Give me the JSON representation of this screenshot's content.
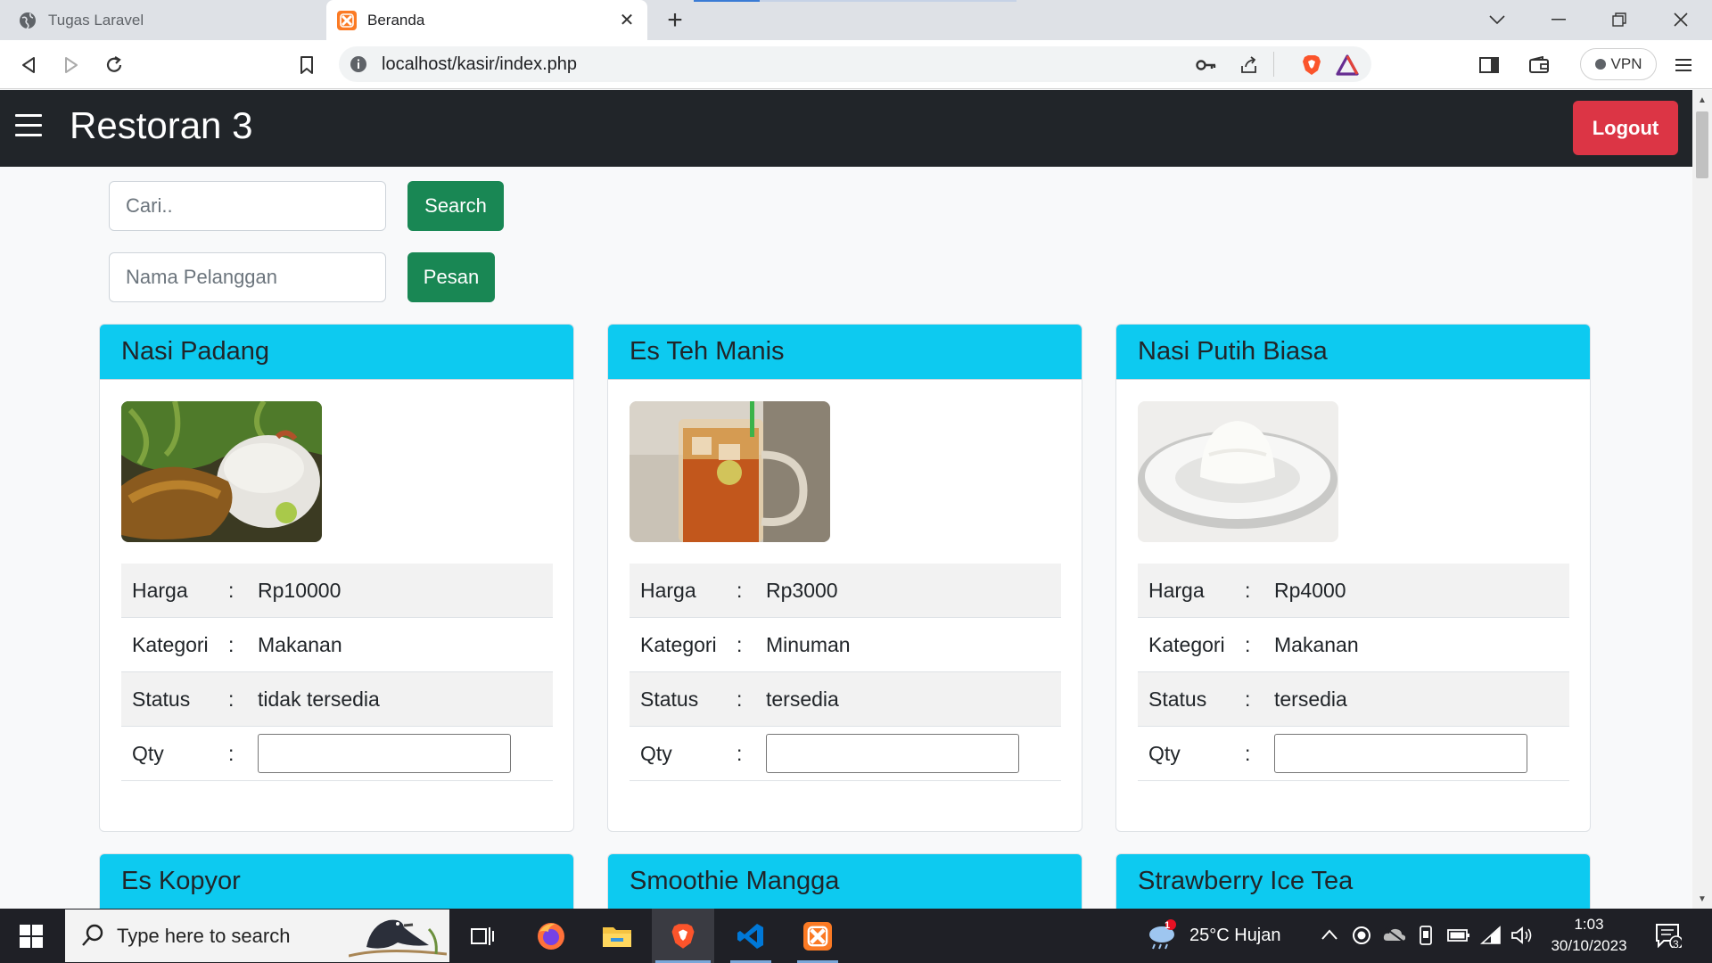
{
  "browser": {
    "tabs": [
      {
        "title": "Tugas Laravel",
        "active": false
      },
      {
        "title": "Beranda",
        "active": true
      }
    ],
    "url": "localhost/kasir/index.php",
    "vpn_label": "VPN"
  },
  "navbar": {
    "brand": "Restoran 3",
    "logout_label": "Logout"
  },
  "search": {
    "placeholder": "Cari..",
    "button_label": "Search"
  },
  "order": {
    "placeholder": "Nama Pelanggan",
    "button_label": "Pesan"
  },
  "labels": {
    "harga": "Harga",
    "kategori": "Kategori",
    "status": "Status",
    "qty": "Qty",
    "colon": ":"
  },
  "menu": [
    {
      "name": "Nasi Padang",
      "harga": "Rp10000",
      "kategori": "Makanan",
      "status": "tidak tersedia"
    },
    {
      "name": "Es Teh Manis",
      "harga": "Rp3000",
      "kategori": "Minuman",
      "status": "tersedia"
    },
    {
      "name": "Nasi Putih Biasa",
      "harga": "Rp4000",
      "kategori": "Makanan",
      "status": "tersedia"
    },
    {
      "name": "Es Kopyor"
    },
    {
      "name": "Smoothie Mangga"
    },
    {
      "name": "Strawberry Ice Tea"
    }
  ],
  "taskbar": {
    "search_placeholder": "Type here to search",
    "weather": "25°C  Hujan",
    "weather_badge": "1",
    "time": "1:03",
    "date": "30/10/2023",
    "notification_count": "3"
  }
}
